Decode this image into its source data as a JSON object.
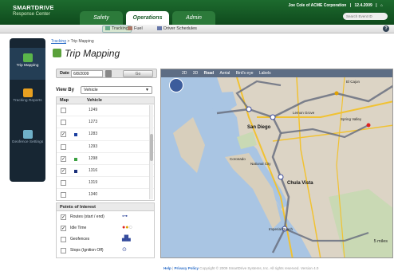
{
  "header": {
    "logo_line1": "SMARTDRIVE",
    "logo_line2": "Response Center",
    "user": "Joe Cole of ACME Corporation",
    "date": "12.4.2009",
    "search_placeholder": "Search Event ID"
  },
  "tabs": [
    {
      "label": "Safety"
    },
    {
      "label": "Operations"
    },
    {
      "label": "Admin"
    }
  ],
  "subnav": [
    {
      "label": "Tracking"
    },
    {
      "label": "Fuel"
    },
    {
      "label": "Driver Schedules"
    }
  ],
  "sidebar": {
    "items": [
      {
        "label": "Trip Mapping"
      },
      {
        "label": "Tracking Reports"
      },
      {
        "label": "Geofence Settings"
      }
    ]
  },
  "breadcrumb": {
    "link": "Tracking",
    "current": "Trip Mapping"
  },
  "page_title": "Trip Mapping",
  "date_filter": {
    "label": "Date",
    "value": "6/8/2009",
    "go_label": "Go"
  },
  "view_by": {
    "label": "View By",
    "selected": "Vehicle"
  },
  "vehicle_table": {
    "headers": [
      "Map",
      "Vehicle"
    ],
    "rows": [
      {
        "vehicle": "1249",
        "checked": false,
        "color": ""
      },
      {
        "vehicle": "1273",
        "checked": false,
        "color": ""
      },
      {
        "vehicle": "1283",
        "checked": true,
        "color": "#1a3fa0"
      },
      {
        "vehicle": "1293",
        "checked": false,
        "color": ""
      },
      {
        "vehicle": "1298",
        "checked": true,
        "color": "#3aa040"
      },
      {
        "vehicle": "1316",
        "checked": true,
        "color": "#1a2f7a"
      },
      {
        "vehicle": "1319",
        "checked": false,
        "color": ""
      },
      {
        "vehicle": "1340",
        "checked": false,
        "color": ""
      }
    ]
  },
  "poi": {
    "title": "Points of Interest",
    "items": [
      {
        "label": "Routes (start / end)",
        "checked": true
      },
      {
        "label": "Idle Time",
        "checked": true
      },
      {
        "label": "Geofences",
        "checked": false
      },
      {
        "label": "Stops (Ignition Off)",
        "checked": false
      }
    ]
  },
  "map": {
    "toolbar": [
      "2D",
      "3D",
      "Road",
      "Aerial",
      "Bird's eye",
      "Labels"
    ],
    "cities": {
      "san_diego": "San Diego",
      "chula_vista": "Chula Vista",
      "national_city": "National City",
      "coronado": "Coronado",
      "imperial_beach": "Imperial Beach",
      "lemon_grove": "Lemon Grove",
      "spring_valley": "Spring Valley",
      "el_cajon": "El Cajon"
    },
    "scale": "5 miles"
  },
  "footer": {
    "help": "Help",
    "privacy": "Privacy Policy",
    "copyright": "Copyright © 2009 SmartDrive Systems, Inc. All rights reserved.",
    "version": "Version 4.0"
  }
}
